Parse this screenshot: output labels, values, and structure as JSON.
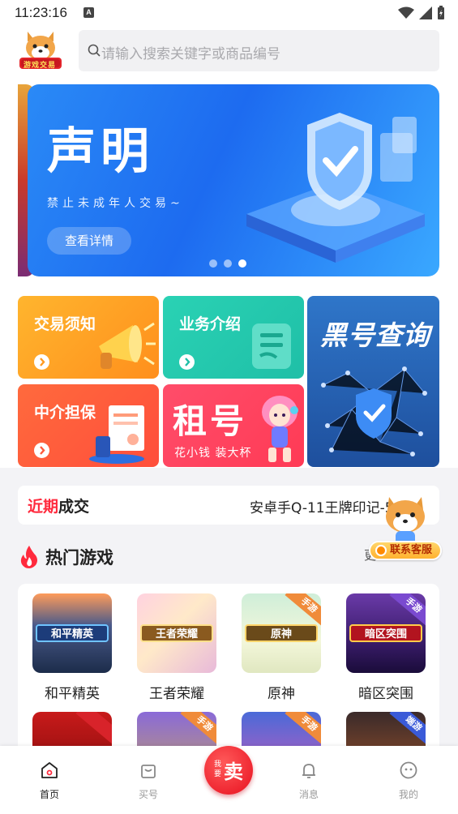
{
  "status_bar": {
    "time": "11:23:16",
    "notification_letter": "A"
  },
  "search": {
    "placeholder": "请输入搜索关键字或商品编号"
  },
  "logo": {
    "text": "游戏交易"
  },
  "banner": {
    "title": "声明",
    "subtitle": "禁止未成年人交易~",
    "button": "查看详情",
    "slide_count": 3,
    "active_slide": 3
  },
  "features": {
    "trade_notice": "交易须知",
    "business_intro": "业务介绍",
    "blacklist_query": "黑号查询",
    "escrow": "中介担保",
    "rent": {
      "title": "租号",
      "slogan": "花小钱  装大杯"
    }
  },
  "recent": {
    "title_red": "近期",
    "title_dark": "成交",
    "ticker": "安卓手Q-11王牌印记-5"
  },
  "hot_games": {
    "title": "热门游戏",
    "more": "更",
    "items": [
      {
        "name": "和平精英",
        "badge": "和平精英"
      },
      {
        "name": "王者荣耀",
        "badge": "王者荣耀"
      },
      {
        "name": "原神",
        "badge": "原神",
        "tag": "手游"
      },
      {
        "name": "暗区突围",
        "badge": "暗区突围",
        "tag": "手游"
      }
    ],
    "row2_tags": [
      "手游",
      "手游",
      "端游"
    ]
  },
  "customer_service": {
    "label": "联系客服"
  },
  "tabbar": {
    "home": "首页",
    "buy": "买号",
    "sell_small": "我要",
    "sell_big": "卖",
    "messages": "消息",
    "mine": "我的"
  },
  "colors": {
    "accent": "#ff2a3d",
    "banner": "#1d6bf0"
  }
}
